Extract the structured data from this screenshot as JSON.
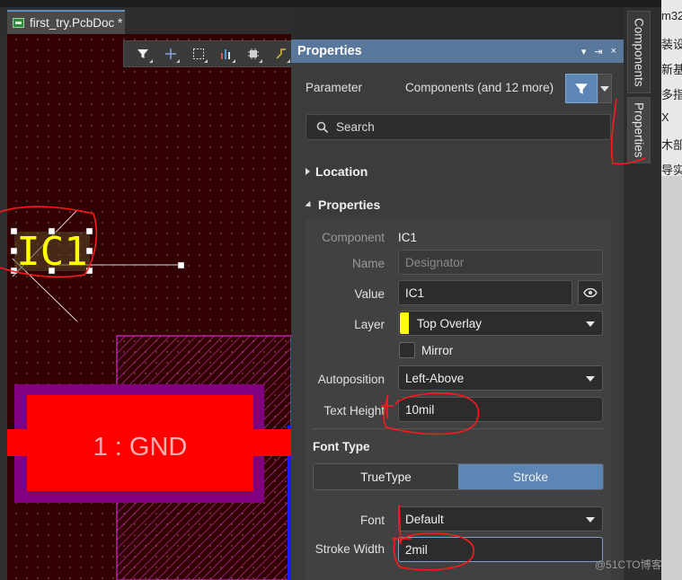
{
  "document_tab": {
    "title": "first_try.PcbDoc *"
  },
  "pcb": {
    "designator_text": "IC1",
    "pad_label": "1 : GND",
    "colors": {
      "board": "#320000",
      "overlay": "#ffff00",
      "pad": "#ff0000",
      "solder_mask": "#800080",
      "keepout": "#ff33ff"
    }
  },
  "canvas_toolbar": {
    "icons": [
      "filter-icon",
      "crosshair-icon",
      "select-rect-icon",
      "chart-icon",
      "chip-icon",
      "route-icon"
    ]
  },
  "panel": {
    "title": "Properties",
    "header_buttons": [
      "▾",
      "⇥",
      "×"
    ],
    "parameter_label": "Parameter",
    "parameter_value": "Components (and 12 more)",
    "search_placeholder": "Search",
    "location_section": "Location",
    "properties_section": "Properties",
    "component_label": "Component",
    "component_value": "IC1",
    "name_label": "Name",
    "name_placeholder": "Designator",
    "value_label": "Value",
    "value_value": "IC1",
    "layer_label": "Layer",
    "layer_value": "Top Overlay",
    "mirror_label": "Mirror",
    "autoposition_label": "Autoposition",
    "autoposition_value": "Left-Above",
    "text_height_label": "Text Height",
    "text_height_value": "10mil",
    "font_type_label": "Font Type",
    "font_type_options": [
      "TrueType",
      "Stroke"
    ],
    "font_type_selected": "Stroke",
    "font_label": "Font",
    "font_value": "Default",
    "stroke_width_label": "Stroke Width",
    "stroke_width_value": "2mil"
  },
  "side_tabs": {
    "components": "Components",
    "properties": "Properties"
  },
  "background_window": {
    "lines": [
      "m32",
      "装设",
      "新基",
      "多指",
      "X",
      "木部",
      "导实"
    ]
  },
  "watermark": "@51CTO博客"
}
